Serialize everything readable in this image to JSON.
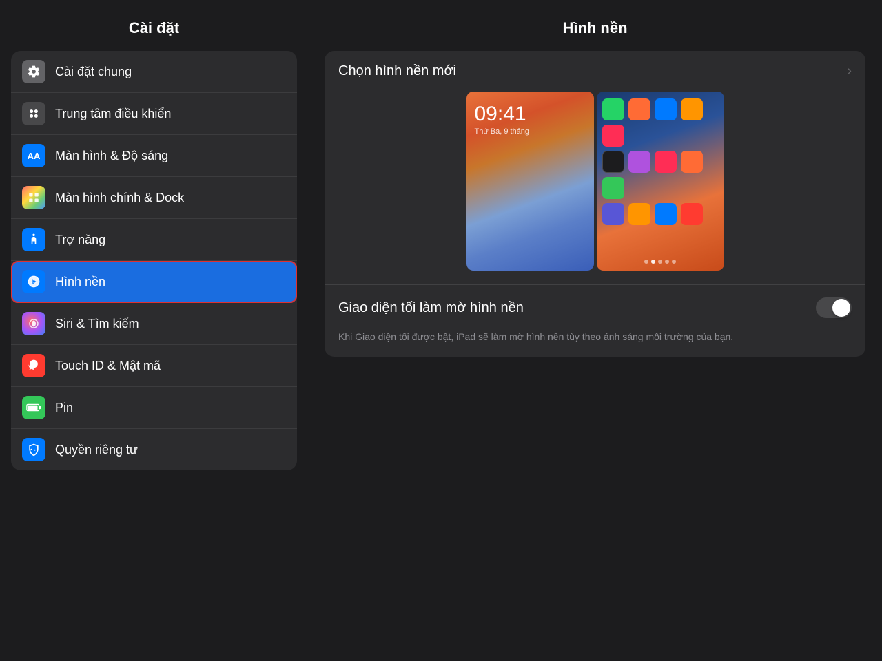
{
  "sidebar": {
    "title": "Cài đặt",
    "items": [
      {
        "id": "general",
        "label": "Cài đặt chung",
        "iconBg": "icon-gray",
        "iconSymbol": "⚙️"
      },
      {
        "id": "control-center",
        "label": "Trung tâm điều khiển",
        "iconBg": "icon-dark-gray",
        "iconSymbol": "⊞"
      },
      {
        "id": "display",
        "label": "Màn hình & Độ sáng",
        "iconBg": "icon-blue",
        "iconSymbol": "AA"
      },
      {
        "id": "home-screen",
        "label": "Màn hình chính & Dock",
        "iconBg": "icon-multi",
        "iconSymbol": "⊞"
      },
      {
        "id": "accessibility",
        "label": "Trợ năng",
        "iconBg": "icon-blue2",
        "iconSymbol": "♿"
      },
      {
        "id": "wallpaper",
        "label": "Hình nền",
        "iconBg": "icon-blue2",
        "iconSymbol": "✦",
        "active": true
      },
      {
        "id": "siri",
        "label": "Siri & Tìm kiếm",
        "iconBg": "icon-siri",
        "iconSymbol": "◎"
      },
      {
        "id": "touch-id",
        "label": "Touch ID & Mật mã",
        "iconBg": "icon-red",
        "iconSymbol": "👆"
      },
      {
        "id": "battery",
        "label": "Pin",
        "iconBg": "icon-green",
        "iconSymbol": "▬"
      },
      {
        "id": "privacy",
        "label": "Quyền riêng tư",
        "iconBg": "icon-blue3",
        "iconSymbol": "✋"
      }
    ]
  },
  "main": {
    "title": "Hình nền",
    "choose_wallpaper_label": "Chọn hình nền mới",
    "dark_mode_label": "Giao diện tối làm mờ hình nền",
    "dark_mode_description": "Khi Giao diện tối được bật, iPad sẽ làm mờ hình nền tùy theo ánh sáng môi trường của bạn.",
    "wallpaper_lock_time": "09:41",
    "wallpaper_lock_date": "Thứ Ba, 9 tháng"
  }
}
